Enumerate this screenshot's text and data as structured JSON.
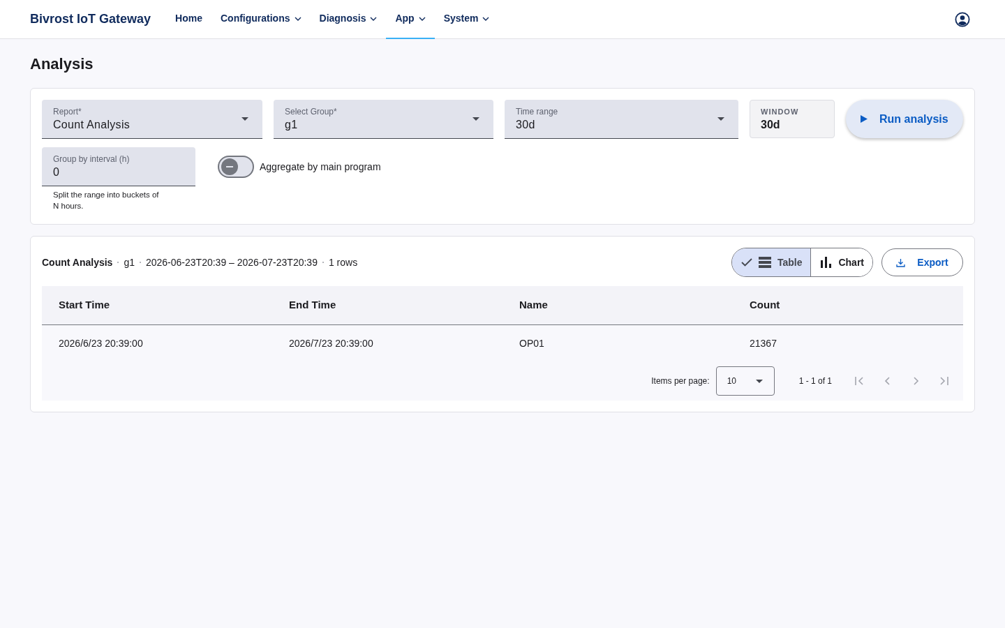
{
  "header": {
    "brand": "Bivrost IoT Gateway",
    "nav": [
      {
        "label": "Home",
        "dropdown": false,
        "selected": false
      },
      {
        "label": "Configurations",
        "dropdown": true,
        "selected": false
      },
      {
        "label": "Diagnosis",
        "dropdown": true,
        "selected": false
      },
      {
        "label": "App",
        "dropdown": true,
        "selected": true
      },
      {
        "label": "System",
        "dropdown": true,
        "selected": false
      }
    ]
  },
  "page_title": "Analysis",
  "form": {
    "selects": [
      {
        "label": "Report*",
        "value": "Count Analysis"
      },
      {
        "label": "Select Group*",
        "value": "g1"
      },
      {
        "label": "Time range",
        "value": "30d"
      }
    ],
    "window": {
      "label": "WINDOW",
      "value": "30d"
    },
    "run_button": "Run analysis",
    "interval": {
      "label": "Group by interval (h)",
      "value": "0",
      "hint": "Split the range into buckets of N hours."
    },
    "aggregate": {
      "label": "Aggregate by main program",
      "on": false
    }
  },
  "results": {
    "summary": [
      {
        "text": "Count Analysis",
        "kind": "title"
      },
      {
        "text": "g1",
        "kind": "plain"
      },
      {
        "text": "2026-06-23T20:39 – 2026-07-23T20:39",
        "kind": "plain"
      },
      {
        "text": "1 rows",
        "kind": "plain"
      }
    ],
    "views": [
      {
        "label": "Table",
        "kind": "table",
        "selected": true
      },
      {
        "label": "Chart",
        "kind": "chart",
        "selected": false
      }
    ],
    "export_button": "Export",
    "table": {
      "columns": [
        "Start Time",
        "End Time",
        "Name",
        "Count"
      ],
      "rows": [
        [
          "2026/6/23 20:39:00",
          "2026/7/23 20:39:00",
          "OP01",
          "21367"
        ]
      ]
    },
    "paginator": {
      "label": "Items per page:",
      "page_size": "10",
      "range": "1 - 1 of 1",
      "buttons": [
        {
          "kind": "first",
          "disabled": true
        },
        {
          "kind": "prev",
          "disabled": true
        },
        {
          "kind": "next",
          "disabled": true
        },
        {
          "kind": "last",
          "disabled": true
        }
      ]
    }
  }
}
